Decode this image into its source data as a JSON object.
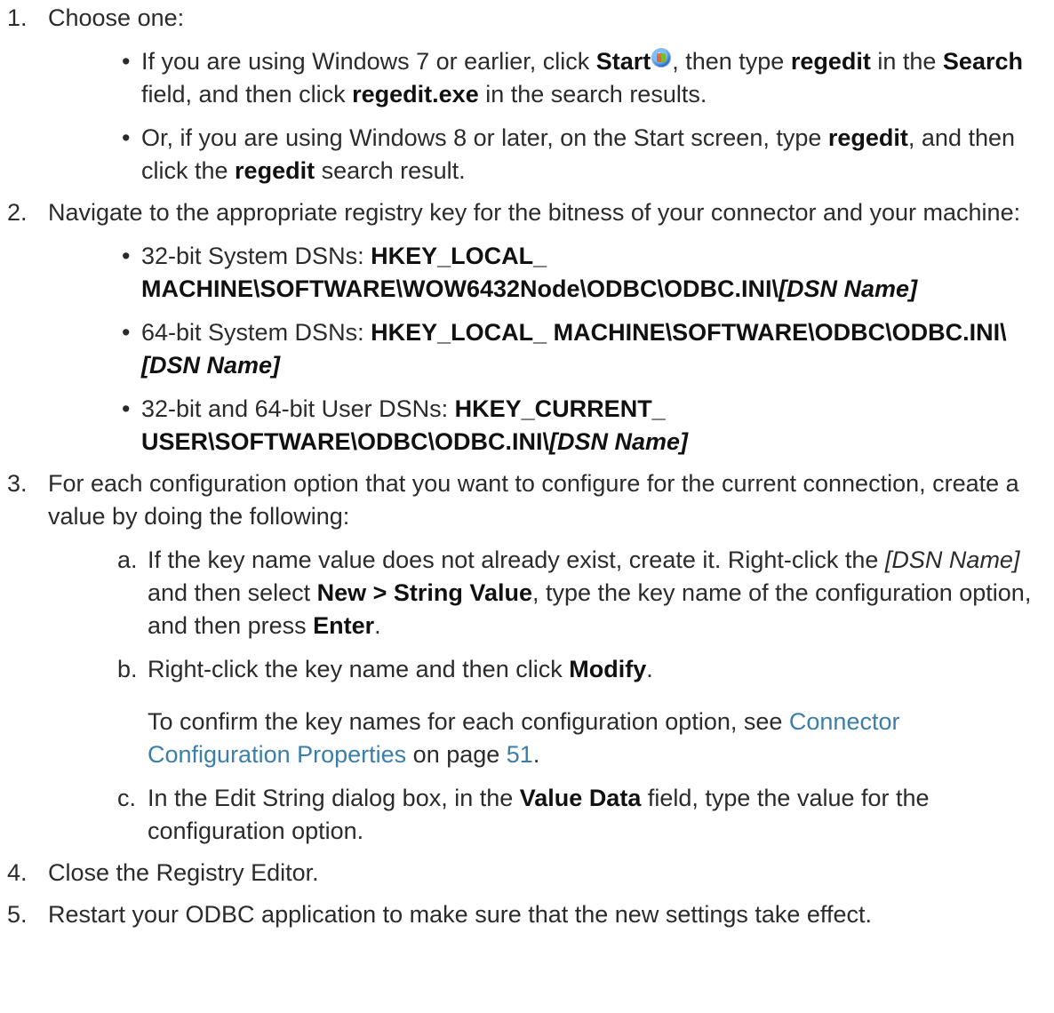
{
  "steps": [
    {
      "num": "1.",
      "intro": "Choose one:",
      "bullets": [
        {
          "p1": "If you are using Windows 7 or earlier, click ",
          "start": "Start",
          "icon": "windows-start-orb-icon",
          "p2": ", then type ",
          "regedit": "regedit",
          "p3": " in the ",
          "search": "Search",
          "p4": " field, and then click ",
          "exe": "regedit.exe",
          "p5": " in the search results."
        },
        {
          "p1": "Or, if you are using Windows 8 or later, on the Start screen, type ",
          "regedit": "regedit",
          "p2": ", and then click the ",
          "regedit2": "regedit",
          "p3": " search result."
        }
      ]
    },
    {
      "num": "2.",
      "intro": "Navigate to the appropriate registry key for the bitness of your connector and your machine:",
      "keys": [
        {
          "label": "32-bit System DSNs: ",
          "path": "HKEY_LOCAL_ MACHINE\\SOFTWARE\\WOW6432Node\\ODBC\\ODBC.INI\\",
          "dsn": "[DSN Name]"
        },
        {
          "label": "64-bit System DSNs: ",
          "path": "HKEY_LOCAL_ MACHINE\\SOFTWARE\\ODBC\\ODBC.INI\\",
          "dsn": "[DSN Name]"
        },
        {
          "label": "32-bit and 64-bit User DSNs: ",
          "path": "HKEY_CURRENT_ USER\\SOFTWARE\\ODBC\\ODBC.INI\\",
          "dsn": "[DSN Name]"
        }
      ]
    },
    {
      "num": "3.",
      "intro": "For each configuration option that you want to configure for the current connection, create a value by doing the following:",
      "subs": [
        {
          "letter": "a.",
          "p1": "If the key name value does not already exist, create it. Right-click the ",
          "dsn": "[DSN Name]",
          "p2": " and then select ",
          "menu": "New > String Value",
          "p3": ", type the key name of the configuration option, and then press ",
          "enter": "Enter",
          "p4": "."
        },
        {
          "letter": "b.",
          "p1": "Right-click the key name and then click ",
          "modify": "Modify",
          "p2": "."
        },
        {
          "letter": "c.",
          "p1": "In the Edit String dialog box, in the ",
          "field": "Value Data",
          "p2": " field, type the value for the configuration option."
        }
      ],
      "note": {
        "p1": "To confirm the key names for each configuration option, see ",
        "link": "Connector Configuration Properties",
        "p2": " on page ",
        "page": "51",
        "p3": "."
      }
    },
    {
      "num": "4.",
      "intro": "Close the Registry Editor."
    },
    {
      "num": "5.",
      "intro": "Restart your ODBC application to make sure that the new settings take effect."
    }
  ],
  "colors": {
    "text": "#2b2b2b",
    "link": "#3b7fa8"
  }
}
